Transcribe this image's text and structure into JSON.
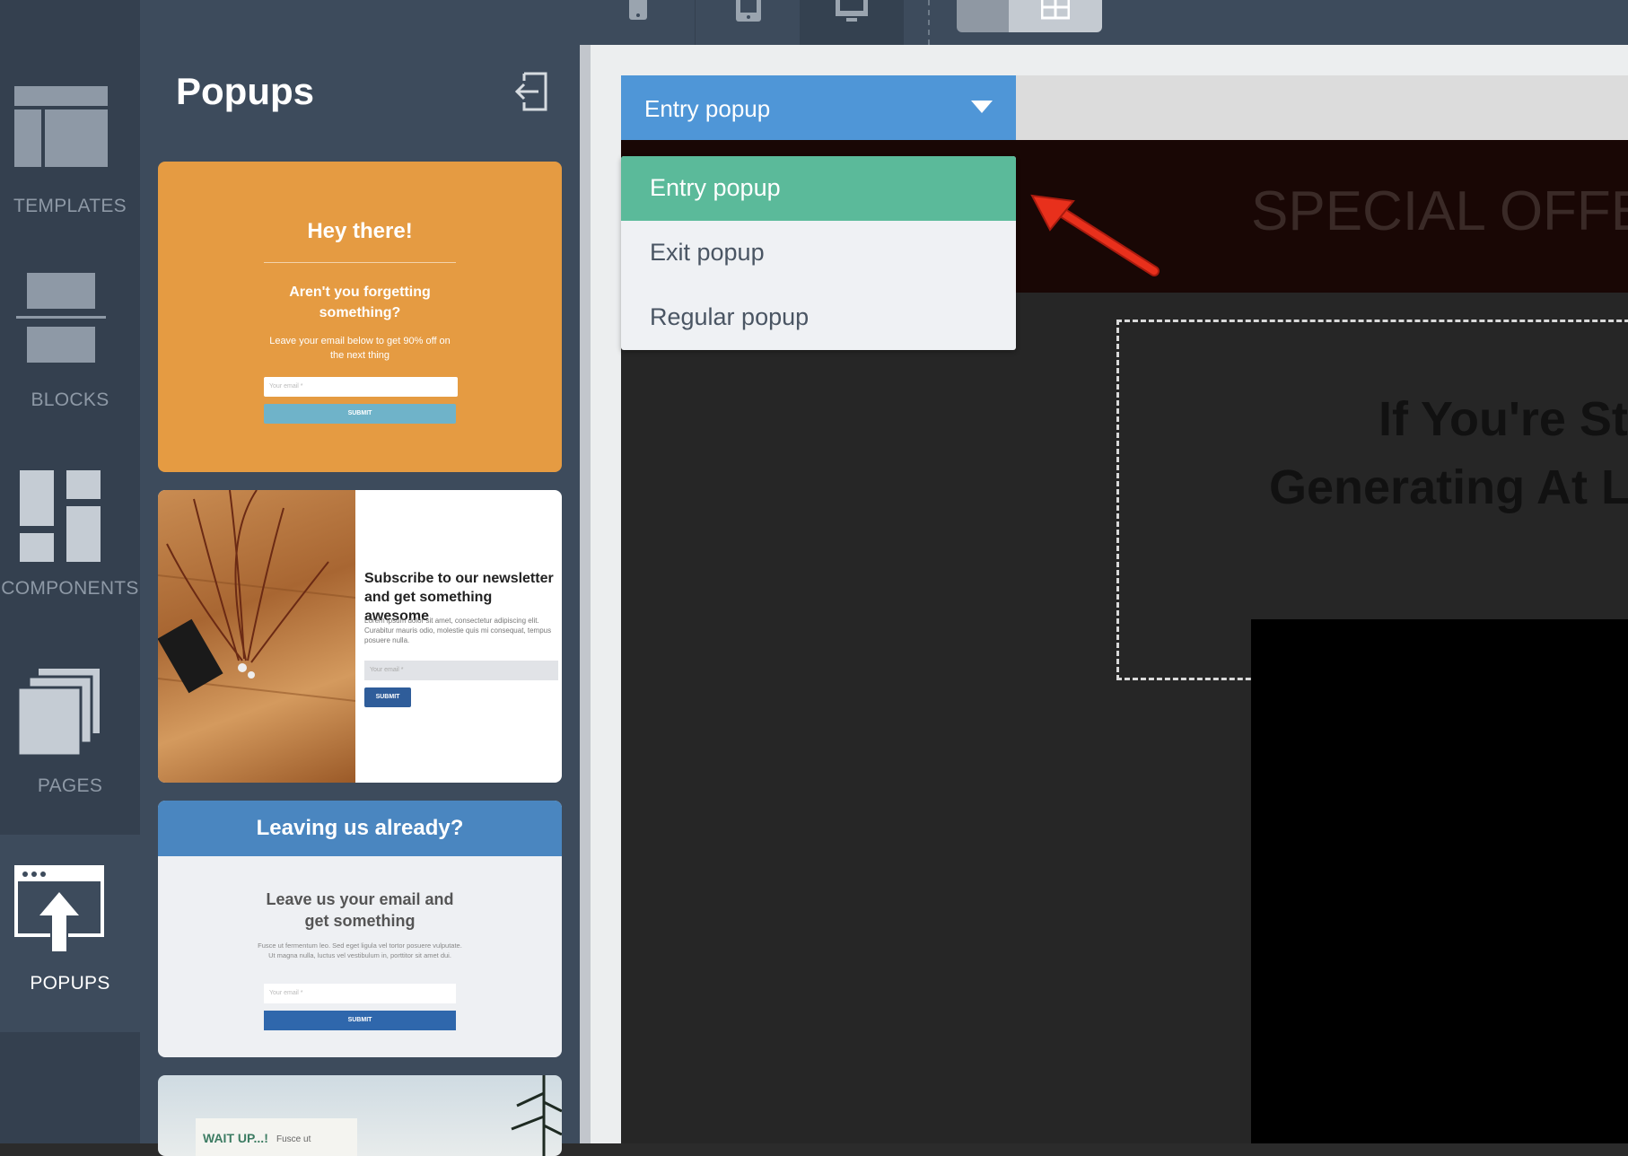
{
  "nav": {
    "items": [
      {
        "label": "TEMPLATES",
        "icon": "templates-icon"
      },
      {
        "label": "BLOCKS",
        "icon": "blocks-icon"
      },
      {
        "label": "COMPONENTS",
        "icon": "components-icon"
      },
      {
        "label": "PAGES",
        "icon": "pages-icon"
      },
      {
        "label": "POPUPS",
        "icon": "popups-icon",
        "active": true
      }
    ]
  },
  "panel": {
    "title": "Popups",
    "cards": [
      {
        "heading": "Hey there!",
        "subheading": "Aren't you forgetting something?",
        "body": "Leave your email below to get 90% off on the next thing",
        "input_placeholder": "Your email *",
        "button": "SUBMIT"
      },
      {
        "heading": "Subscribe to our newsletter and get something awesome",
        "body": "Lorem ipsum dolor sit amet, consectetur adipiscing elit. Curabitur mauris odio, molestie quis mi consequat, tempus posuere nulla.",
        "input_placeholder": "Your email *",
        "button": "SUBMIT"
      },
      {
        "header": "Leaving us already?",
        "subheading": "Leave us your email and get something",
        "body": "Fusce ut fermentum leo. Sed eget ligula vel tortor posuere vulputate. Ut magna nulla, luctus vel vestibulum in, porttitor sit amet dui.",
        "input_placeholder": "Your email *",
        "button": "SUBMIT"
      },
      {
        "heading": "WAIT UP...!",
        "body": "Fusce ut"
      }
    ]
  },
  "toolbar": {
    "icons": [
      "phone-portrait-icon",
      "tablet-icon",
      "desktop-icon",
      "grid-icon"
    ]
  },
  "dropdown": {
    "selected": "Entry popup",
    "options": [
      "Entry popup",
      "Exit popup",
      "Regular popup"
    ]
  },
  "canvas": {
    "offer_text": "SPECIAL OFFER:",
    "headline_line1": "If You're St",
    "headline_line2": "Generating At L"
  },
  "colors": {
    "accent_blue": "#4f96d7",
    "selected_green": "#5bba9a",
    "annotation_arrow": "#e8301c"
  }
}
